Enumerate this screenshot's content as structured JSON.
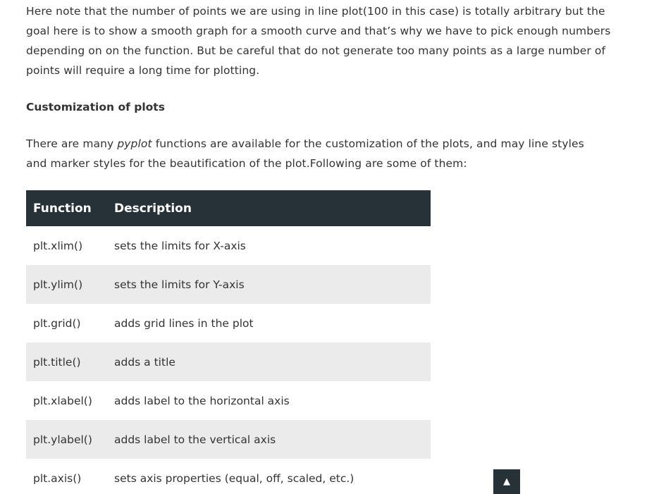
{
  "article": {
    "para1": "Here note that the number of points we are using in line plot(100 in this case) is totally arbitrary but the goal here is to show a smooth graph for a smooth curve and that’s why we have to pick enough numbers depending on on the function. But be careful that do not generate too many points as a large number of points will require a long time for plotting.",
    "heading": "Customization of plots",
    "para2_before": "There are many ",
    "para2_em": "pyplot",
    "para2_after": " functions are available for the customization of the plots, and may line styles and marker styles for the beautification of the plot.Following are some of them:"
  },
  "table": {
    "headers": {
      "function": "Function",
      "description": "Description"
    },
    "rows": [
      {
        "fn": "plt.xlim()",
        "desc": "sets the limits for X-axis"
      },
      {
        "fn": "plt.ylim()",
        "desc": "sets the limits for Y-axis"
      },
      {
        "fn": "plt.grid()",
        "desc": "adds grid lines in the plot"
      },
      {
        "fn": "plt.title()",
        "desc": "adds a title"
      },
      {
        "fn": "plt.xlabel()",
        "desc": "adds label to the horizontal axis"
      },
      {
        "fn": "plt.ylabel()",
        "desc": "adds label to the vertical axis"
      },
      {
        "fn": "plt.axis()",
        "desc": "sets axis properties (equal, off, scaled, etc.)"
      }
    ]
  },
  "scroll_top": {
    "icon": "arrow-up-icon",
    "glyph": "▲"
  }
}
